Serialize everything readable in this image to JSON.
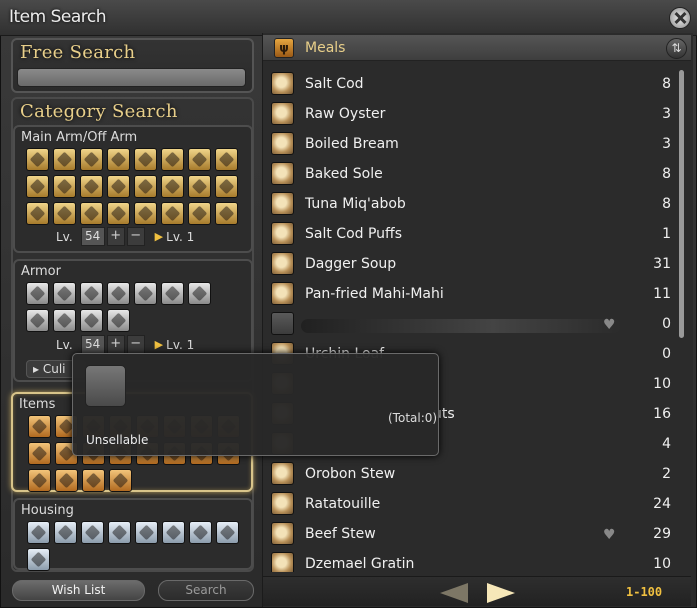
{
  "window": {
    "title": "Item Search"
  },
  "free_search": {
    "heading": "Free Search",
    "value": "",
    "placeholder": ""
  },
  "category_search": {
    "heading": "Category Search",
    "main_arm": {
      "label": "Main Arm/Off Arm",
      "level_prefix": "Lv.",
      "level_value": "54",
      "plus": "+",
      "minus": "−",
      "target_level": "Lv. 1"
    },
    "armor": {
      "label": "Armor",
      "level_prefix": "Lv.",
      "level_value": "54",
      "plus": "+",
      "minus": "−",
      "target_level": "Lv. 1"
    },
    "culinary_button": "Culi",
    "items": {
      "label": "Items"
    },
    "housing": {
      "label": "Housing"
    }
  },
  "buttons": {
    "wish_list": "Wish List",
    "search": "Search"
  },
  "results": {
    "category": "Meals",
    "category_icon": "fork-knife-icon",
    "sort_icon": "sort-icon",
    "rows": [
      {
        "name": "Salt Cod",
        "count": "8",
        "favorite": false
      },
      {
        "name": "Raw Oyster",
        "count": "3",
        "favorite": false
      },
      {
        "name": "Boiled Bream",
        "count": "3",
        "favorite": false
      },
      {
        "name": "Baked Sole",
        "count": "8",
        "favorite": false
      },
      {
        "name": "Tuna Miq'abob",
        "count": "8",
        "favorite": false
      },
      {
        "name": "Salt Cod Puffs",
        "count": "1",
        "favorite": false
      },
      {
        "name": "Dagger Soup",
        "count": "31",
        "favorite": false
      },
      {
        "name": "Pan-fried Mahi-Mahi",
        "count": "11",
        "favorite": false
      },
      {
        "name": "",
        "count": "0",
        "favorite": true,
        "unknown": true
      },
      {
        "name": "Urchin Loaf",
        "count": "0",
        "favorite": false
      },
      {
        "name": "",
        "count": "10",
        "favorite": false
      },
      {
        "name": "uts",
        "count": "16",
        "favorite": false
      },
      {
        "name": "",
        "count": "4",
        "favorite": false
      },
      {
        "name": "Orobon Stew",
        "count": "2",
        "favorite": false
      },
      {
        "name": "Ratatouille",
        "count": "24",
        "favorite": false
      },
      {
        "name": "Beef Stew",
        "count": "29",
        "favorite": true
      },
      {
        "name": "Dzemael Gratin",
        "count": "10",
        "favorite": false
      }
    ],
    "page_range": "1-100"
  },
  "tooltip": {
    "total": "(Total:0)",
    "note": "Unsellable"
  },
  "colors": {
    "accent_gold": "#e8cf8a",
    "page_gold": "#f0c040"
  }
}
